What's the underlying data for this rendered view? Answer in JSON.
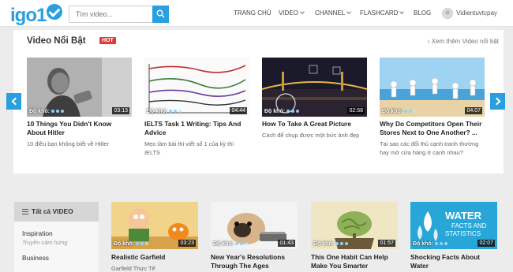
{
  "header": {
    "logo": "igo1",
    "search": {
      "placeholder": "Tìm video..."
    },
    "nav": [
      {
        "label": "TRANG CHỦ"
      },
      {
        "label": "VIDEO"
      },
      {
        "label": "CHANNEL"
      },
      {
        "label": "FLASHCARD"
      },
      {
        "label": "BLOG"
      }
    ],
    "user_name": "Vidientuvtcpay"
  },
  "featured": {
    "title": "Video Nổi Bật",
    "badge": "HOT",
    "see_more": "› Xem thêm Video nổi bật",
    "difficulty_label": "Độ khó:",
    "cards": [
      {
        "title": "10 Things You Didn't Know About Hitler",
        "desc": "10 điều bạn không biết về Hitler",
        "duration": "03:13",
        "difficulty": 2
      },
      {
        "title": "IELTS Task 1 Writing: Tips And Advice",
        "desc": "Mẹo làm bài thi viết số 1 của kỳ thi IELTS",
        "duration": "04:44",
        "difficulty": 2
      },
      {
        "title": "How To Take A Great Picture",
        "desc": "Cách để chụp được một bức ảnh đẹp",
        "duration": "02:58",
        "difficulty": 2
      },
      {
        "title": "Why Do Competitors Open Their Stores Next to One Another? ...",
        "desc": "Tại sao các đối thủ cạnh tranh thường hay mở cửa hàng ở cạnh nhau?",
        "duration": "04:07",
        "difficulty": 2
      }
    ]
  },
  "categories": {
    "header": "Tất cả VIDEO",
    "items": [
      {
        "name": "Inspiration",
        "sub": "Truyền cảm hứng"
      },
      {
        "name": "Business",
        "sub": ""
      }
    ]
  },
  "bottom_cards": [
    {
      "title": "Realistic Garfield",
      "desc": "Garfield Thực Tế",
      "duration": "03:23"
    },
    {
      "title": "New Year's Resolutions Through The Ages",
      "desc": "",
      "duration": "01:43"
    },
    {
      "title": "This One Habit Can Help Make You Smarter",
      "desc": "",
      "duration": "01:57"
    },
    {
      "title": "Shocking Facts About Water",
      "desc": "",
      "duration": "02:07",
      "thumb_text": [
        "WATER",
        "FACTS AND",
        "STATISTICS"
      ]
    }
  ],
  "colors": {
    "accent": "#2a9fe0",
    "hot": "#e03a3a"
  }
}
